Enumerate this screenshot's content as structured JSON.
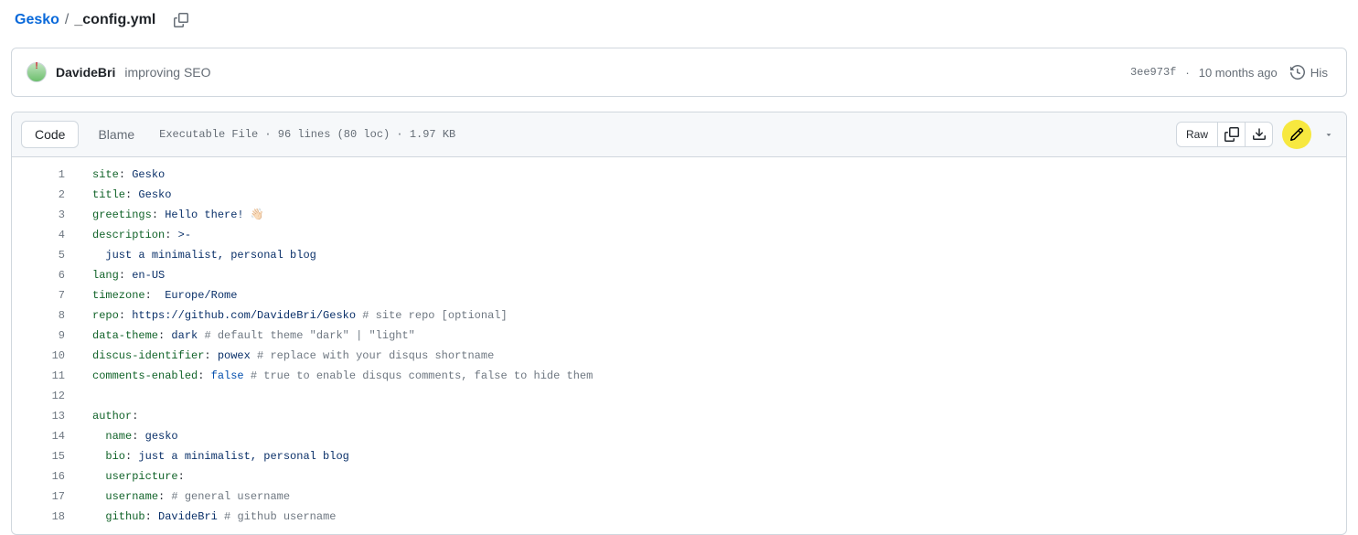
{
  "breadcrumbs": {
    "repo": "Gesko",
    "sep": "/",
    "file": "_config.yml"
  },
  "commit": {
    "author": "DavideBri",
    "message": "improving SEO",
    "hash": "3ee973f",
    "sep": "·",
    "time": "10 months ago",
    "history_label": "His"
  },
  "toolbar": {
    "code_label": "Code",
    "blame_label": "Blame",
    "meta_type": "Executable File",
    "meta_lines": "96 lines (80 loc)",
    "meta_size": "1.97 KB",
    "meta_sep": "·",
    "raw_label": "Raw"
  },
  "code": {
    "lines": [
      {
        "n": 1,
        "t": [
          {
            "c": "pl-ent",
            "v": "site"
          },
          {
            "c": "pl-p",
            "v": ": "
          },
          {
            "c": "pl-s",
            "v": "Gesko"
          }
        ]
      },
      {
        "n": 2,
        "t": [
          {
            "c": "pl-ent",
            "v": "title"
          },
          {
            "c": "pl-p",
            "v": ": "
          },
          {
            "c": "pl-s",
            "v": "Gesko"
          }
        ]
      },
      {
        "n": 3,
        "t": [
          {
            "c": "pl-ent",
            "v": "greetings"
          },
          {
            "c": "pl-p",
            "v": ": "
          },
          {
            "c": "pl-s",
            "v": "Hello there! 👋🏻"
          }
        ]
      },
      {
        "n": 4,
        "t": [
          {
            "c": "pl-ent",
            "v": "description"
          },
          {
            "c": "pl-p",
            "v": ": "
          },
          {
            "c": "pl-s",
            "v": ">-"
          }
        ]
      },
      {
        "n": 5,
        "t": [
          {
            "c": "pl-p",
            "v": "  "
          },
          {
            "c": "pl-s",
            "v": "just a minimalist, personal blog"
          }
        ]
      },
      {
        "n": 6,
        "t": [
          {
            "c": "pl-ent",
            "v": "lang"
          },
          {
            "c": "pl-p",
            "v": ": "
          },
          {
            "c": "pl-s",
            "v": "en-US"
          }
        ]
      },
      {
        "n": 7,
        "t": [
          {
            "c": "pl-ent",
            "v": "timezone"
          },
          {
            "c": "pl-p",
            "v": ":  "
          },
          {
            "c": "pl-s",
            "v": "Europe/Rome"
          }
        ]
      },
      {
        "n": 8,
        "t": [
          {
            "c": "pl-ent",
            "v": "repo"
          },
          {
            "c": "pl-p",
            "v": ": "
          },
          {
            "c": "pl-s",
            "v": "https://github.com/DavideBri/Gesko"
          },
          {
            "c": "pl-p",
            "v": " "
          },
          {
            "c": "pl-c",
            "v": "# site repo [optional]"
          }
        ]
      },
      {
        "n": 9,
        "t": [
          {
            "c": "pl-ent",
            "v": "data-theme"
          },
          {
            "c": "pl-p",
            "v": ": "
          },
          {
            "c": "pl-s",
            "v": "dark"
          },
          {
            "c": "pl-p",
            "v": " "
          },
          {
            "c": "pl-c",
            "v": "# default theme \"dark\" | \"light\""
          }
        ]
      },
      {
        "n": 10,
        "t": [
          {
            "c": "pl-ent",
            "v": "discus-identifier"
          },
          {
            "c": "pl-p",
            "v": ": "
          },
          {
            "c": "pl-s",
            "v": "powex"
          },
          {
            "c": "pl-p",
            "v": " "
          },
          {
            "c": "pl-c",
            "v": "# replace with your disqus shortname"
          }
        ]
      },
      {
        "n": 11,
        "t": [
          {
            "c": "pl-ent",
            "v": "comments-enabled"
          },
          {
            "c": "pl-p",
            "v": ": "
          },
          {
            "c": "pl-c1",
            "v": "false"
          },
          {
            "c": "pl-p",
            "v": " "
          },
          {
            "c": "pl-c",
            "v": "# true to enable disqus comments, false to hide them"
          }
        ]
      },
      {
        "n": 12,
        "t": [
          {
            "c": "pl-p",
            "v": " "
          }
        ]
      },
      {
        "n": 13,
        "t": [
          {
            "c": "pl-ent",
            "v": "author"
          },
          {
            "c": "pl-p",
            "v": ":"
          }
        ]
      },
      {
        "n": 14,
        "t": [
          {
            "c": "pl-p",
            "v": "  "
          },
          {
            "c": "pl-ent",
            "v": "name"
          },
          {
            "c": "pl-p",
            "v": ": "
          },
          {
            "c": "pl-s",
            "v": "gesko"
          }
        ]
      },
      {
        "n": 15,
        "t": [
          {
            "c": "pl-p",
            "v": "  "
          },
          {
            "c": "pl-ent",
            "v": "bio"
          },
          {
            "c": "pl-p",
            "v": ": "
          },
          {
            "c": "pl-s",
            "v": "just a minimalist, personal blog"
          }
        ]
      },
      {
        "n": 16,
        "t": [
          {
            "c": "pl-p",
            "v": "  "
          },
          {
            "c": "pl-ent",
            "v": "userpicture"
          },
          {
            "c": "pl-p",
            "v": ":"
          }
        ]
      },
      {
        "n": 17,
        "t": [
          {
            "c": "pl-p",
            "v": "  "
          },
          {
            "c": "pl-ent",
            "v": "username"
          },
          {
            "c": "pl-p",
            "v": ": "
          },
          {
            "c": "pl-c",
            "v": "# general username"
          }
        ]
      },
      {
        "n": 18,
        "t": [
          {
            "c": "pl-p",
            "v": "  "
          },
          {
            "c": "pl-ent",
            "v": "github"
          },
          {
            "c": "pl-p",
            "v": ": "
          },
          {
            "c": "pl-s",
            "v": "DavideBri"
          },
          {
            "c": "pl-p",
            "v": " "
          },
          {
            "c": "pl-c",
            "v": "# github username"
          }
        ]
      }
    ]
  }
}
